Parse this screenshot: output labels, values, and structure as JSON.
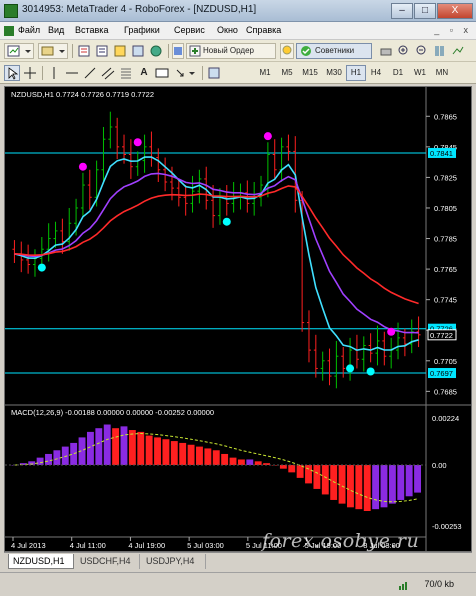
{
  "window": {
    "title": "3014953: MetaTrader 4 - RoboForex - [NZDUSD,H1]",
    "buttons": [
      "–",
      "□",
      "X"
    ]
  },
  "menu": [
    "Файл",
    "Вид",
    "Вставка",
    "Графики",
    "Сервис",
    "Окно",
    "Справка"
  ],
  "mdi_controls": "_ ▫ x",
  "toolbar1": {
    "new_order": "Новый Ордер",
    "advisors": "Советники"
  },
  "toolbar2": {
    "timeframes": [
      "M1",
      "M5",
      "M15",
      "M30",
      "H1",
      "H4",
      "D1",
      "W1",
      "MN"
    ],
    "active_timeframe": "H1"
  },
  "chart": {
    "header": "NZDUSD,H1  0.7724 0.7726 0.7719 0.7722",
    "macd_header": "MACD(12,26,9) -0.00188 0.00000 0.00000 -0.00252 0.00000",
    "price_ticks": [
      "0.7865",
      "0.7845",
      "0.7825",
      "0.7805",
      "0.7785",
      "0.7765",
      "0.7745",
      "0.7725",
      "0.7705",
      "0.7685"
    ],
    "price_tags": [
      "0.7841",
      "0.7726",
      "0.7722",
      "0.7697"
    ],
    "macd_ticks": [
      "0.00224",
      "0.00",
      "-0.00253"
    ],
    "time_ticks": [
      "4 Jul 2013",
      "4 Jul 11:00",
      "4 Jul 19:00",
      "5 Jul 03:00",
      "5 Jul 11:00",
      "5 Jul 19:00",
      "8 Jul 03:00"
    ],
    "colors": {
      "bull": "#00c000",
      "bear": "#ff2020",
      "level": "#00e5ff",
      "ma_fast": "#40e0ff",
      "ma_mid": "#a040ff",
      "ma_slow": "#ff2a2a",
      "macd_pos": "#8a2be2",
      "macd_neg": "#ff2020",
      "signal": "#c8e632",
      "dot_magenta": "#ff00ff",
      "dot_cyan": "#00ffff"
    }
  },
  "chart_data": {
    "type": "candlestick",
    "symbol": "NZDUSD",
    "timeframe": "H1",
    "ylim": [
      0.768,
      0.7875
    ],
    "closes": [
      0.7775,
      0.7771,
      0.7768,
      0.7772,
      0.7778,
      0.7785,
      0.779,
      0.7783,
      0.7795,
      0.7805,
      0.782,
      0.7812,
      0.783,
      0.785,
      0.7858,
      0.7845,
      0.784,
      0.7832,
      0.7836,
      0.7845,
      0.7838,
      0.783,
      0.7822,
      0.7818,
      0.7812,
      0.7808,
      0.7816,
      0.7824,
      0.781,
      0.78,
      0.7812,
      0.7808,
      0.7812,
      0.7815,
      0.7808,
      0.7812,
      0.782,
      0.784,
      0.783,
      0.7845,
      0.7842,
      0.781,
      0.773,
      0.7712,
      0.77,
      0.7705,
      0.7695,
      0.7708,
      0.77,
      0.7712,
      0.7706,
      0.7715,
      0.771,
      0.7718,
      0.7708,
      0.7712,
      0.772,
      0.7716,
      0.7724,
      0.7722
    ],
    "macd_hist": [
      0.0,
      0.0001,
      0.0002,
      0.0004,
      0.0006,
      0.0008,
      0.001,
      0.0012,
      0.0015,
      0.0018,
      0.002,
      0.0022,
      0.002,
      0.0021,
      0.0019,
      0.0018,
      0.0016,
      0.0015,
      0.0014,
      0.0013,
      0.0012,
      0.0011,
      0.001,
      0.0009,
      0.0008,
      0.0006,
      0.0004,
      0.0003,
      0.0003,
      0.0002,
      0.0001,
      0.0,
      -0.0002,
      -0.0004,
      -0.0007,
      -0.001,
      -0.0013,
      -0.0016,
      -0.0019,
      -0.0021,
      -0.0023,
      -0.0024,
      -0.0025,
      -0.0024,
      -0.0023,
      -0.0021,
      -0.0019,
      -0.0017,
      -0.0015
    ]
  },
  "tabs": [
    "NZDUSD,H1",
    "USDCHF,H4",
    "USDJPY,H4"
  ],
  "status": {
    "kb": "70/0 kb"
  },
  "watermark": "forex.osobye.ru"
}
